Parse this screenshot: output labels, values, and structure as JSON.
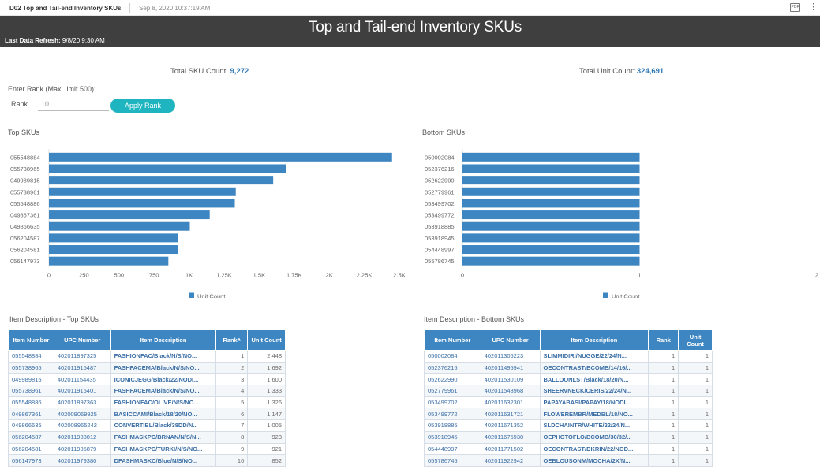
{
  "header": {
    "tab_label": "D02 Top and Tail-end Inventory SKUs",
    "timestamp": "Sep 8, 2020 10:37:19 AM",
    "export_label": "PDF",
    "more_label": "⋮"
  },
  "banner": {
    "title": "Top and Tail-end Inventory SKUs",
    "refresh_label": "Last Data Refresh:",
    "refresh_value": "9/8/20 9:30 AM"
  },
  "kpis": {
    "sku_label": "Total SKU Count:",
    "sku_value": "9,272",
    "unit_label": "Total Unit Count:",
    "unit_value": "324,691"
  },
  "rank_form": {
    "title": "Enter Rank (Max. limit 500):",
    "label": "Rank",
    "value": "10",
    "button": "Apply Rank"
  },
  "colors": {
    "bar": "#3e86c2",
    "button": "#1fb5c0",
    "header": "#3f3f3f",
    "accent": "#2e78b7"
  },
  "chart_data": [
    {
      "type": "bar",
      "orientation": "horizontal",
      "title": "Top SKUs",
      "categories": [
        "055548884",
        "055738965",
        "049989815",
        "055738961",
        "055548886",
        "049867361",
        "049866635",
        "056204587",
        "056204581",
        "056147973"
      ],
      "series": [
        {
          "name": "Unit Count",
          "values": [
            2448,
            1692,
            1600,
            1333,
            1326,
            1147,
            1005,
            923,
            921,
            852
          ]
        }
      ],
      "xlim": [
        0,
        2500
      ],
      "xticks": [
        "0",
        "250",
        "500",
        "750",
        "1K",
        "1.25K",
        "1.5K",
        "1.75K",
        "2K",
        "2.25K",
        "2.5K"
      ],
      "legend": "bottom"
    },
    {
      "type": "bar",
      "orientation": "horizontal",
      "title": "Bottom SKUs",
      "categories": [
        "050002084",
        "052376216",
        "052622990",
        "052779961",
        "053499702",
        "053499772",
        "053918885",
        "053918945",
        "054448997",
        "055786745"
      ],
      "series": [
        {
          "name": "Unit Count",
          "values": [
            1,
            1,
            1,
            1,
            1,
            1,
            1,
            1,
            1,
            1
          ]
        }
      ],
      "xlim": [
        0,
        2
      ],
      "xticks": [
        "0",
        "1",
        "2"
      ],
      "legend": "bottom"
    }
  ],
  "top_table": {
    "title": "Item Description - Top SKUs",
    "headers": [
      "Item Number",
      "UPC Number",
      "Item Description",
      "Rank˄",
      "Unit Count"
    ],
    "rows": [
      [
        "055548884",
        "402011897325",
        "FASHIONFAC/Black/N/S/NO...",
        "1",
        "2,448"
      ],
      [
        "055738965",
        "402011915487",
        "FASHFACEMA/Black/N/S/NO...",
        "2",
        "1,692"
      ],
      [
        "049989815",
        "402011154435",
        "ICONICJEGG/Black/22/NODI...",
        "3",
        "1,600"
      ],
      [
        "055738961",
        "402011915401",
        "FASHFACEMA/Black/N/S/NO...",
        "4",
        "1,333"
      ],
      [
        "055548886",
        "402011897363",
        "FASHIONFAC/OLIVE/N/S/NO...",
        "5",
        "1,326"
      ],
      [
        "049867361",
        "402009069925",
        "BASICCAMI/Black/18/20/NO...",
        "6",
        "1,147"
      ],
      [
        "049866635",
        "402008965242",
        "CONVERTIBL/Black/38DD/N...",
        "7",
        "1,005"
      ],
      [
        "056204587",
        "402011988012",
        "FASHMASKPC/BRNAN/N/S/N...",
        "8",
        "923"
      ],
      [
        "056204581",
        "402011985879",
        "FASHMASKPC/TURKI/N/S/NO...",
        "9",
        "921"
      ],
      [
        "056147973",
        "402011979380",
        "DFASHMASKC/Blue/N/S/NO...",
        "10",
        "852"
      ]
    ]
  },
  "bottom_table": {
    "title": "Item Description - Bottom SKUs",
    "headers": [
      "Item Number",
      "UPC Number",
      "Item Description",
      "Rank",
      "Unit Count"
    ],
    "rows": [
      [
        "050002084",
        "402011306223",
        "SLIMMIDIRI/NUGGE/22/24/N...",
        "1",
        "1"
      ],
      [
        "052376216",
        "402011495941",
        "OECONTRAST/BCOMB/14/16/...",
        "1",
        "1"
      ],
      [
        "052622990",
        "402011530109",
        "BALLOONLST/Black/18/20/N...",
        "1",
        "1"
      ],
      [
        "052779961",
        "402011548968",
        "SHEERVNECK/CERIS/22/24/N...",
        "1",
        "1"
      ],
      [
        "053499702",
        "402011632301",
        "PAPAYABASI/PAPAY/18/NODI...",
        "1",
        "1"
      ],
      [
        "053499772",
        "402011631721",
        "FLOWEREMBR/MEDBL/18/NO...",
        "1",
        "1"
      ],
      [
        "053918885",
        "402011671352",
        "SLDCHAINTR/WHITE/22/24/N...",
        "1",
        "1"
      ],
      [
        "053918945",
        "402011675930",
        "OEPHOTOFLO/BCOMB/30/32/...",
        "1",
        "1"
      ],
      [
        "054448997",
        "402011771502",
        "OECONTRAST/DKRIN/22/NOD...",
        "1",
        "1"
      ],
      [
        "055786745",
        "402011922942",
        "OEBLOUSONM/MOCHA/2X/N...",
        "1",
        "1"
      ]
    ]
  }
}
